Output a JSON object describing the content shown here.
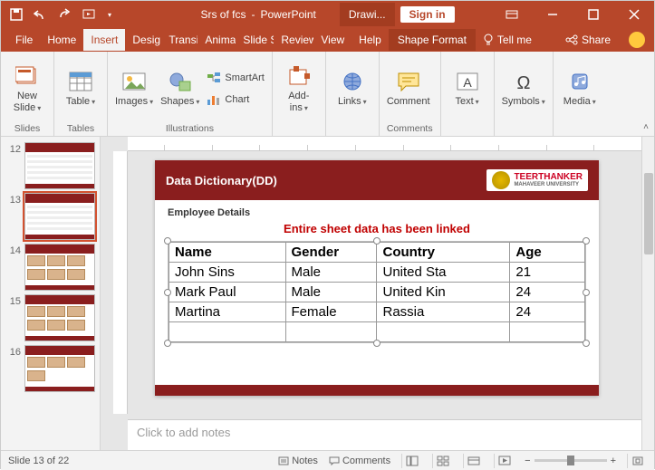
{
  "titlebar": {
    "doc": "Srs of fcs",
    "app": "PowerPoint",
    "context_tab": "Drawi...",
    "signin": "Sign in"
  },
  "tabs": {
    "file": "File",
    "home": "Home",
    "insert": "Insert",
    "design": "Desig",
    "transitions": "Transi",
    "animations": "Anima",
    "slideshow": "Slide S",
    "review": "Review",
    "view": "View",
    "help": "Help",
    "shapeformat": "Shape Format",
    "tellme": "Tell me",
    "share": "Share"
  },
  "ribbon": {
    "newslide": "New\nSlide",
    "table": "Table",
    "images": "Images",
    "shapes": "Shapes",
    "smartart": "SmartArt",
    "chart": "Chart",
    "addins": "Add-\nins",
    "links": "Links",
    "comment": "Comment",
    "text": "Text",
    "symbols": "Symbols",
    "media": "Media",
    "grp_slides": "Slides",
    "grp_tables": "Tables",
    "grp_illustrations": "Illustrations",
    "grp_comments": "Comments"
  },
  "thumbs": {
    "n12": "12",
    "n13": "13",
    "n14": "14",
    "n15": "15",
    "n16": "16"
  },
  "slide": {
    "title": "Data Dictionary(DD)",
    "logo_top": "TEERTHANKER",
    "logo_bottom": "MAHAVEER UNIVERSITY",
    "subtitle": "Employee Details",
    "note": "Entire sheet data has been linked",
    "headers": {
      "c0": "Name",
      "c1": "Gender",
      "c2": "Country",
      "c3": "Age"
    },
    "rows": [
      {
        "c0": "John Sins",
        "c1": "Male",
        "c2": "United Sta",
        "c3": "21"
      },
      {
        "c0": "Mark Paul",
        "c1": "Male",
        "c2": "United Kin",
        "c3": "24"
      },
      {
        "c0": "Martina",
        "c1": "Female",
        "c2": "Rassia",
        "c3": "24"
      }
    ]
  },
  "notes_placeholder": "Click to add notes",
  "status": {
    "slide": "Slide 13 of 22",
    "notes": "Notes",
    "comments": "Comments",
    "zoom_minus": "−",
    "zoom_plus": "+"
  }
}
